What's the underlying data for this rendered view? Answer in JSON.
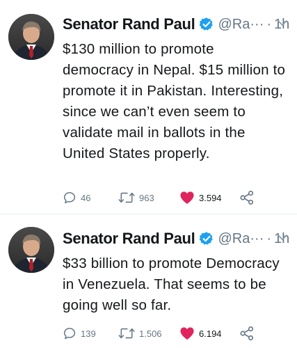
{
  "tweets": [
    {
      "display_name": "Senator Rand Paul",
      "handle": "@Ra···",
      "separator": "·",
      "time": "1h",
      "text_lines": [
        "$130 million to promote",
        "democracy in Nepal. $15 million to",
        "promote it in Pakistan. Interesting,",
        "since we can’t even seem to",
        "validate mail in ballots in the",
        "United States properly."
      ],
      "replies": "46",
      "retweets": "963",
      "likes": "3.594"
    },
    {
      "display_name": "Senator Rand Paul",
      "handle": "@Ra···",
      "separator": "·",
      "time": "1h",
      "text_lines": [
        "$33 billion to promote Democracy",
        "in Venezuela. That seems to be",
        "going well so far."
      ],
      "replies": "139",
      "retweets": "1.506",
      "likes": "6.194"
    }
  ],
  "icons": {
    "verified": "verified-badge-icon",
    "caret": "chevron-down-icon",
    "reply": "reply-icon",
    "retweet": "retweet-icon",
    "like": "heart-icon",
    "share": "share-icon"
  },
  "colors": {
    "verified_blue": "#1da1f2",
    "like_red": "#e0245e",
    "muted_gray": "#657786",
    "text": "#14171a"
  }
}
